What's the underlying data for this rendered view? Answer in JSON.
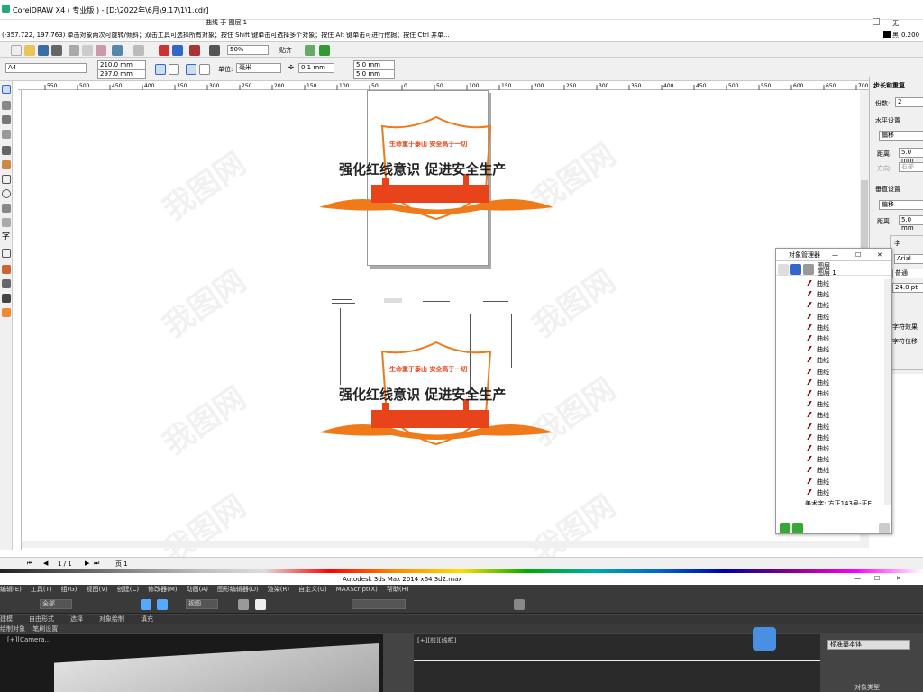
{
  "app": {
    "title": "CorelDRAW X4 ( 专业版 ) - [D:\\2022年\\6月\\9.17\\1\\1.cdr]",
    "context": "曲线 于 图层 1",
    "fill_label": "无",
    "outline_label": "黑",
    "outline_width": "0.200 毫米"
  },
  "status": {
    "text": "(-357.722, 197.763)  单击对象两次可旋转/倾斜；双击工具可选择所有对象；按住 Shift 键单击可选择多个对象；按住 Alt 键单击可进行挖掘；按住 Ctrl 并单..."
  },
  "toolbar": {
    "zoom": "50%",
    "snap": "贴齐"
  },
  "property_bar": {
    "page_size": "A4",
    "width": "210.0 mm",
    "height": "297.0 mm",
    "unit_label": "单位:",
    "unit": "毫米",
    "nudge": "0.1 mm",
    "dup_x": "5.0 mm",
    "dup_y": "5.0 mm"
  },
  "ruler": {
    "top_ticks": [
      "550",
      "500",
      "450",
      "400",
      "350",
      "300",
      "250",
      "200",
      "150",
      "100",
      "50",
      "0",
      "50",
      "100",
      "150",
      "200",
      "250",
      "300",
      "350",
      "400",
      "450",
      "500",
      "550",
      "600",
      "650",
      "700"
    ]
  },
  "design": {
    "slogan_top": "生命重于泰山  安全高于一切",
    "slogan_main": "强化红线意识  促进安全生产",
    "orange": "#f07a1a",
    "red": "#e8431a"
  },
  "right_dock": {
    "title": "步长和重复",
    "copies_label": "份数:",
    "copies_value": "2",
    "horizontal": "水平设置",
    "offset": "偏移",
    "distance_label": "距离:",
    "distance_value": "5.0 mm",
    "direction_label": "方向:",
    "direction_value": "右部",
    "vertical": "垂直设置",
    "v_offset": "偏移",
    "v_distance_value": "5.0 mm",
    "char_tab": "字",
    "font": "Arial",
    "font_style": "普通",
    "font_size": "24.0 pt",
    "char_effect": "字符效果",
    "char_shift": "字符位移"
  },
  "object_manager": {
    "title": "对象管理器",
    "layer_a": "图层",
    "layer_b": "图层 1",
    "items": [
      "曲线",
      "曲线",
      "曲线",
      "曲线",
      "曲线",
      "曲线",
      "曲线",
      "曲线",
      "曲线",
      "曲线",
      "曲线",
      "曲线",
      "曲线",
      "曲线",
      "曲线",
      "曲线",
      "曲线",
      "曲线",
      "曲线",
      "曲线"
    ],
    "last_item": "美术字: 方正143号-正E..."
  },
  "pagebar": {
    "page_count": "1 / 1",
    "page_tab": "页 1"
  },
  "max": {
    "title": "Autodesk 3ds Max  2014 x64     3d2.max",
    "menus": [
      "编辑(E)",
      "工具(T)",
      "组(G)",
      "视图(V)",
      "创建(C)",
      "修改器(M)",
      "动画(A)",
      "图形编辑器(D)",
      "渲染(R)",
      "自定义(U)",
      "MAXScript(X)",
      "帮助(H)"
    ],
    "select_all": "全部",
    "view": "视图",
    "ribbon": [
      "建模",
      "自由形式",
      "选择",
      "对象绘制",
      "填充"
    ],
    "sub1": "绘制对象",
    "sub2": "笔刷设置",
    "vp_label": "[+][Camera...",
    "vp2_label": "[+][前][线框]",
    "cmd_label": "标准基本体",
    "cmd_type": "对象类型"
  },
  "watermark": "我图网"
}
